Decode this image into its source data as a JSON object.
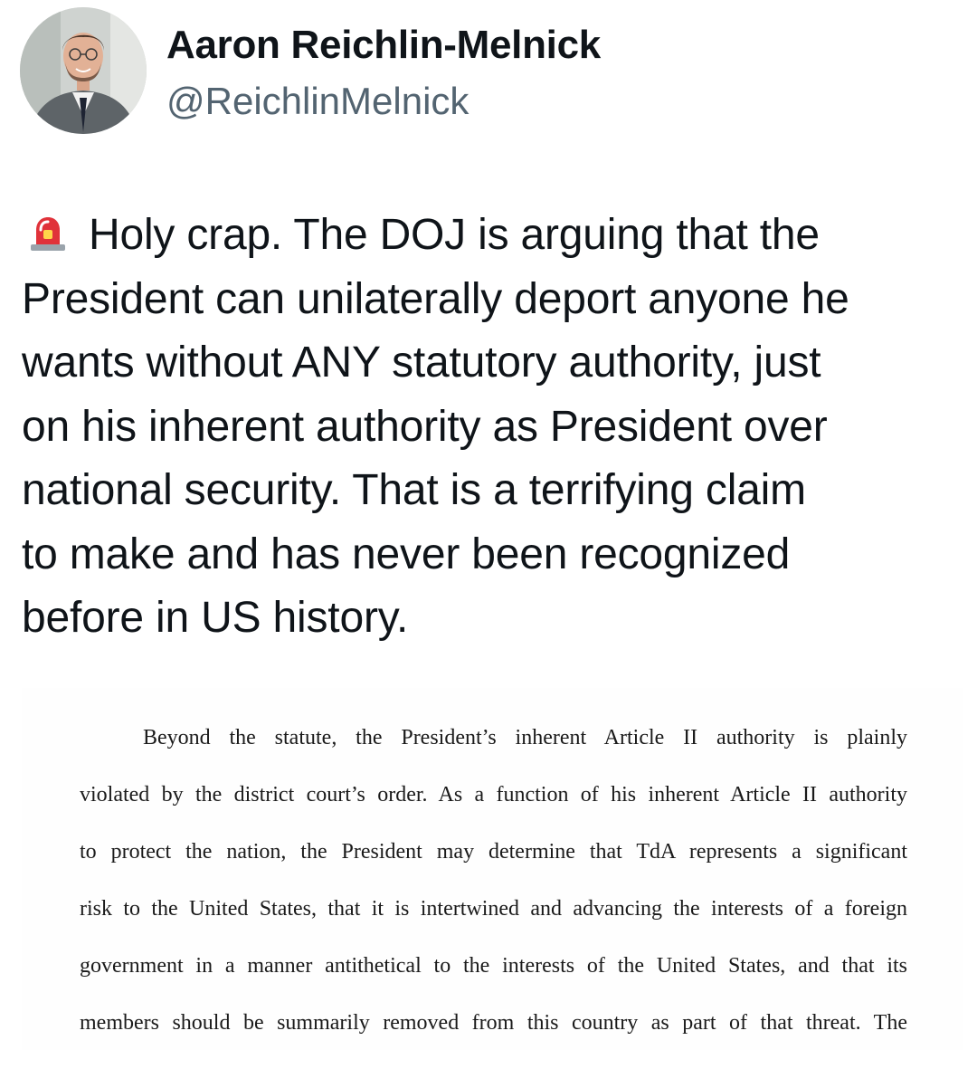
{
  "post": {
    "author": {
      "name": "Aaron Reichlin-Melnick",
      "handle": "@ReichlinMelnick",
      "avatar_icon": "profile-photo"
    },
    "emoji_icon": "police-car-light",
    "text": "Holy crap. The DOJ is arguing that the\nPresident can unilaterally deport anyone he\nwants without ANY statutory authority, just\non his inherent authority as President over\nnational security.  That is a terrifying claim\nto make and has never been recognized\nbefore in US history."
  },
  "document_excerpt": {
    "lines": [
      "Beyond the statute, the President’s inherent Article II authority is plainly",
      "violated by the district court’s order.  As a function of his inherent Article II authority",
      "to protect the nation, the President may determine that TdA represents a significant",
      "risk to the United States, that it is intertwined and advancing the interests of a foreign",
      "government in a manner antithetical to the interests of the United States, and that its",
      "members should be summarily removed from this country as part of that threat.  The"
    ]
  },
  "colors": {
    "text": "#0f1419",
    "handle": "#536471",
    "siren_red": "#e0323a"
  }
}
